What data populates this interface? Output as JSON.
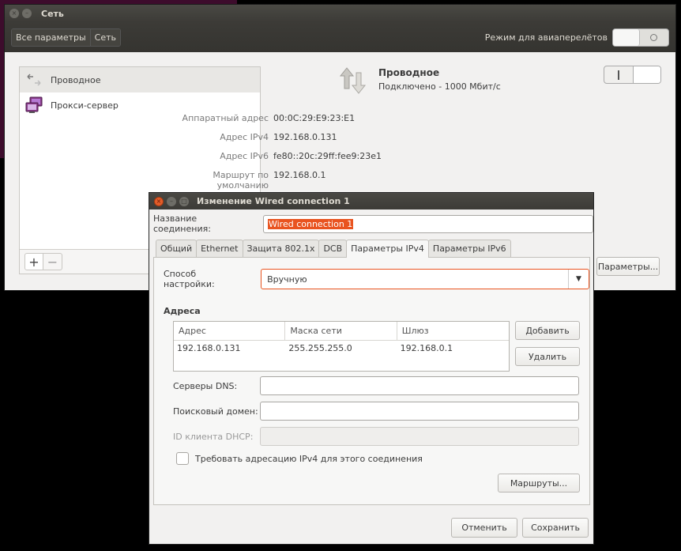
{
  "main_window": {
    "title": "Сеть",
    "breadcrumbs": [
      "Все параметры",
      "Сеть"
    ],
    "airplane_label": "Режим для авиаперелётов",
    "sidebar": {
      "items": [
        {
          "label": "Проводное",
          "icon": "wired-network-icon",
          "selected": true
        },
        {
          "label": "Прокси-сервер",
          "icon": "proxy-server-icon",
          "selected": false
        }
      ],
      "add_label": "+",
      "remove_label": "−"
    },
    "detail": {
      "title": "Проводное",
      "status": "Подключено - 1000 Мбит/с",
      "rows": [
        {
          "label": "Аппаратный адрес",
          "value": "00:0C:29:E9:23:E1"
        },
        {
          "label": "Адрес IPv4",
          "value": "192.168.0.131"
        },
        {
          "label": "Адрес IPv6",
          "value": "fe80::20c:29ff:fee9:23e1"
        },
        {
          "label": "Маршрут по умолчанию",
          "value": "192.168.0.1"
        }
      ],
      "params_button": "Параметры..."
    }
  },
  "dialog": {
    "title": "Изменение Wired connection 1",
    "conn_name_label": "Название соединения:",
    "conn_name_value": "Wired connection 1",
    "tabs": [
      "Общий",
      "Ethernet",
      "Защита 802.1x",
      "DCB",
      "Параметры IPv4",
      "Параметры IPv6"
    ],
    "active_tab": "Параметры IPv4",
    "method_label": "Способ настройки:",
    "method_value": "Вручную",
    "addresses_heading": "Адреса",
    "table": {
      "columns": [
        "Адрес",
        "Маска сети",
        "Шлюз"
      ],
      "rows": [
        [
          "192.168.0.131",
          "255.255.255.0",
          "192.168.0.1"
        ]
      ]
    },
    "add_button": "Добавить",
    "delete_button": "Удалить",
    "dns_label": "Серверы DNS:",
    "dns_value": "",
    "search_label": "Поисковый домен:",
    "search_value": "",
    "dhcp_label": "ID клиента DHCP:",
    "dhcp_value": "",
    "require_label": "Требовать адресацию IPv4 для этого соединения",
    "routes_button": "Маршруты...",
    "cancel_button": "Отменить",
    "save_button": "Сохранить"
  },
  "colors": {
    "accent": "#e95420",
    "titlebar": "#3c3b37",
    "window_bg": "#f2f1f0"
  }
}
